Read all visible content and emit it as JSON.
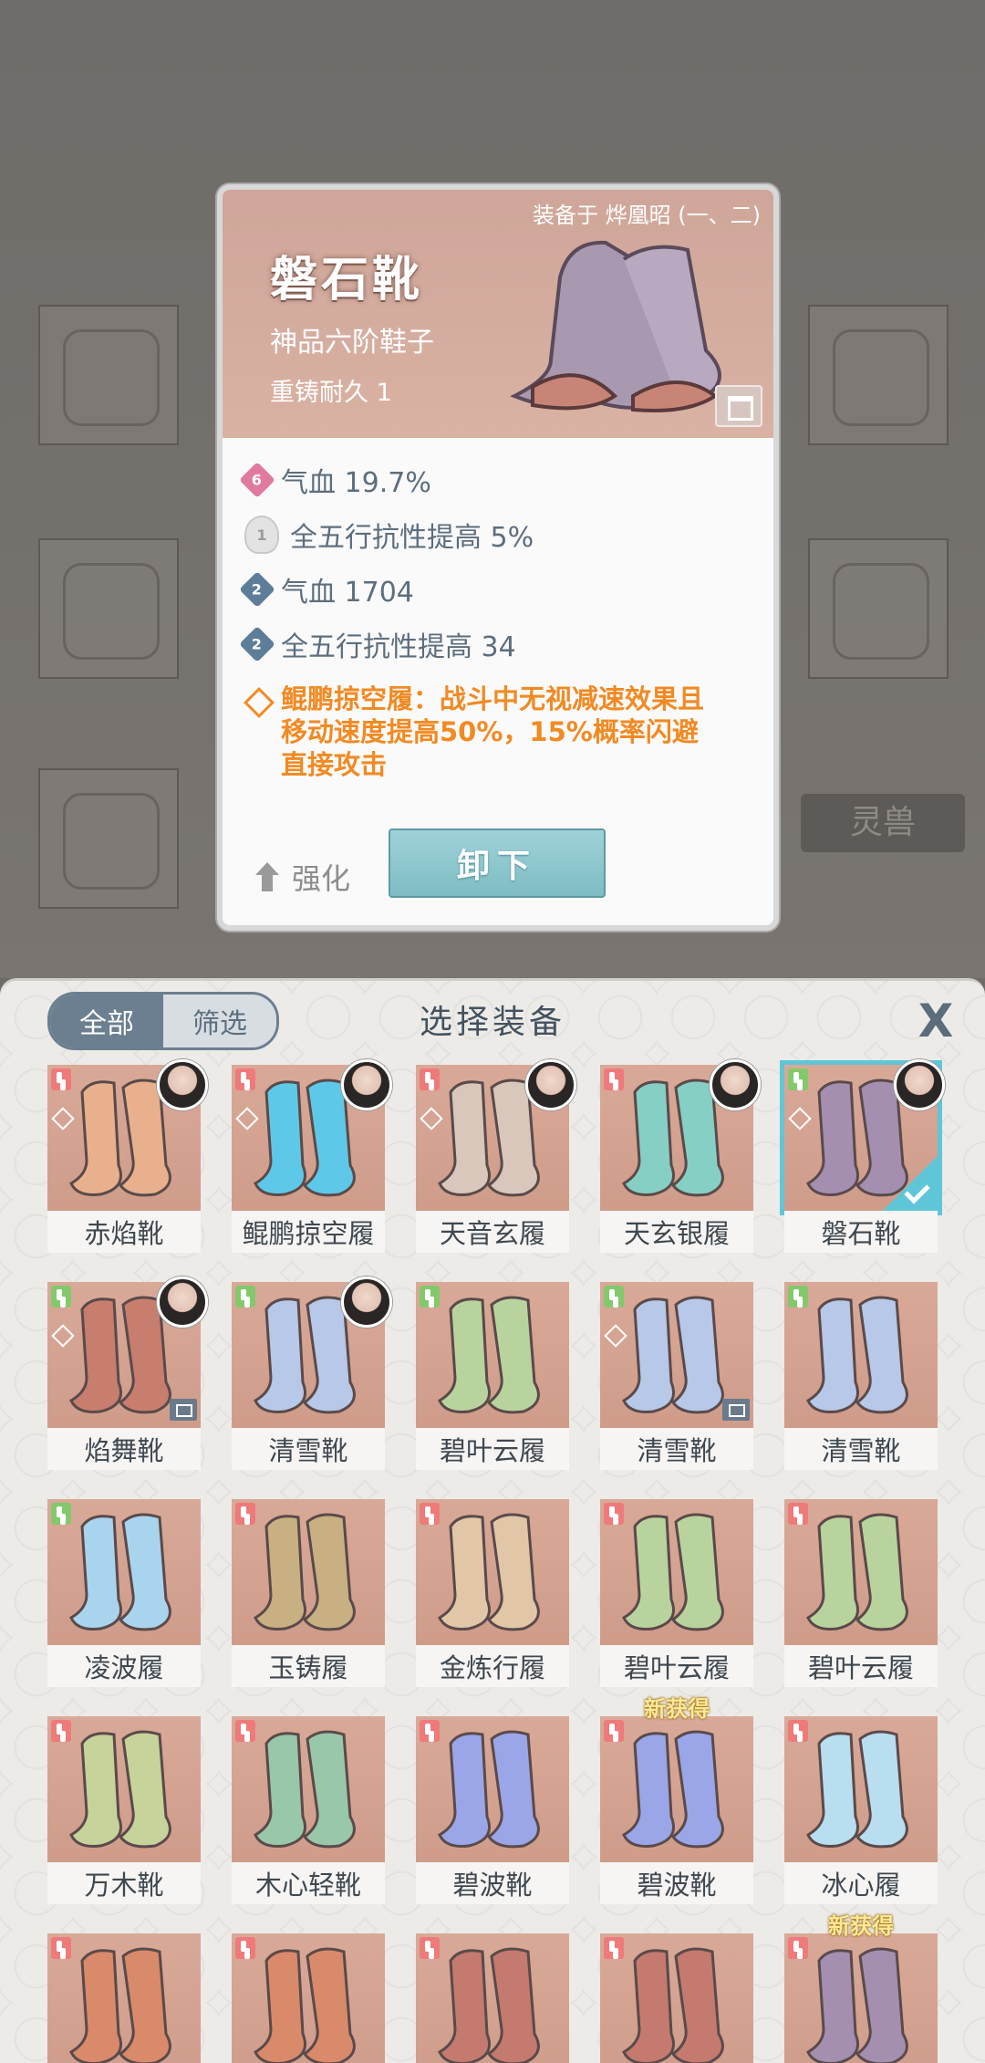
{
  "detail": {
    "equipped_on": "装备于 烨凰昭 (一、二)",
    "name": "磐石靴",
    "grade": "神品六阶鞋子",
    "recast": "重铸耐久 1",
    "stats": [
      {
        "badge": "6",
        "text": "气血 19.7%",
        "color": "pink"
      },
      {
        "badge": "1",
        "text": "全五行抗性提高 5%",
        "color": "flame"
      },
      {
        "badge": "2",
        "text": "气血 1704",
        "color": "blue"
      },
      {
        "badge": "2",
        "text": "全五行抗性提高 34",
        "color": "blue"
      }
    ],
    "skill_lines": [
      "鲲鹏掠空履：战斗中无视减速效果且",
      "移动速度提高50%，15%概率闪避",
      "直接攻击"
    ],
    "enhance_label": "强化",
    "unequip_label": "卸下",
    "accent_color": "#f28a23"
  },
  "background": {
    "tab_label": "灵兽"
  },
  "panel": {
    "title": "选择装备",
    "filter_all": "全部",
    "filter_screen": "筛选",
    "close_symbol": "X",
    "new_badge_text": "新获得",
    "items": [
      {
        "name": "赤焰靴",
        "tone": "#e8b08c",
        "slot": "red",
        "rank": true,
        "portrait": true
      },
      {
        "name": "鲲鹏掠空履",
        "tone": "#5ec8e8",
        "slot": "red",
        "rank": true,
        "portrait": true
      },
      {
        "name": "天音玄履",
        "tone": "#d8c7ba",
        "slot": "red",
        "rank": true,
        "portrait": true
      },
      {
        "name": "天玄银履",
        "tone": "#86cfc4",
        "slot": "red",
        "rank": false,
        "portrait": true
      },
      {
        "name": "磐石靴",
        "tone": "#a58fb0",
        "slot": "green",
        "rank": true,
        "portrait": true,
        "selected": true
      },
      {
        "name": "焰舞靴",
        "tone": "#c77e6e",
        "slot": "green",
        "rank": true,
        "portrait": true,
        "lock": true
      },
      {
        "name": "清雪靴",
        "tone": "#b7c8e8",
        "slot": "green",
        "rank": false,
        "portrait": true
      },
      {
        "name": "碧叶云履",
        "tone": "#b9d39e",
        "slot": "green",
        "rank": false,
        "portrait": false
      },
      {
        "name": "清雪靴",
        "tone": "#b7c8e8",
        "slot": "green",
        "rank": true,
        "portrait": false,
        "lock": true
      },
      {
        "name": "清雪靴",
        "tone": "#b7c8e8",
        "slot": "green",
        "rank": false,
        "portrait": false
      },
      {
        "name": "凌波履",
        "tone": "#a9d4ee",
        "slot": "green",
        "rank": false,
        "portrait": false
      },
      {
        "name": "玉铸履",
        "tone": "#c9b083",
        "slot": "red",
        "rank": false,
        "portrait": false
      },
      {
        "name": "金炼行履",
        "tone": "#e1c6a8",
        "slot": "red",
        "rank": false,
        "portrait": false
      },
      {
        "name": "碧叶云履",
        "tone": "#b9d39e",
        "slot": "red",
        "rank": false,
        "portrait": false
      },
      {
        "name": "碧叶云履",
        "tone": "#b9d39e",
        "slot": "red",
        "rank": false,
        "portrait": false
      },
      {
        "name": "万木靴",
        "tone": "#c6d39a",
        "slot": "red",
        "rank": false,
        "portrait": false
      },
      {
        "name": "木心轻靴",
        "tone": "#98c7a9",
        "slot": "red",
        "rank": false,
        "portrait": false
      },
      {
        "name": "碧波靴",
        "tone": "#9aa6e8",
        "slot": "red",
        "rank": false,
        "portrait": false
      },
      {
        "name": "碧波靴",
        "tone": "#9aa6e8",
        "slot": "red",
        "rank": false,
        "portrait": false,
        "new": true
      },
      {
        "name": "冰心履",
        "tone": "#b8def0",
        "slot": "red",
        "rank": false,
        "portrait": false
      },
      {
        "name": "",
        "tone": "#d98a6a",
        "slot": "red",
        "rank": false,
        "portrait": false
      },
      {
        "name": "",
        "tone": "#d98a6a",
        "slot": "red",
        "rank": false,
        "portrait": false
      },
      {
        "name": "",
        "tone": "#c47a6f",
        "slot": "red",
        "rank": false,
        "portrait": false
      },
      {
        "name": "",
        "tone": "#c47a6f",
        "slot": "red",
        "rank": false,
        "portrait": false
      },
      {
        "name": "",
        "tone": "#a58fb0",
        "slot": "red",
        "rank": false,
        "portrait": false,
        "new": true
      }
    ]
  }
}
